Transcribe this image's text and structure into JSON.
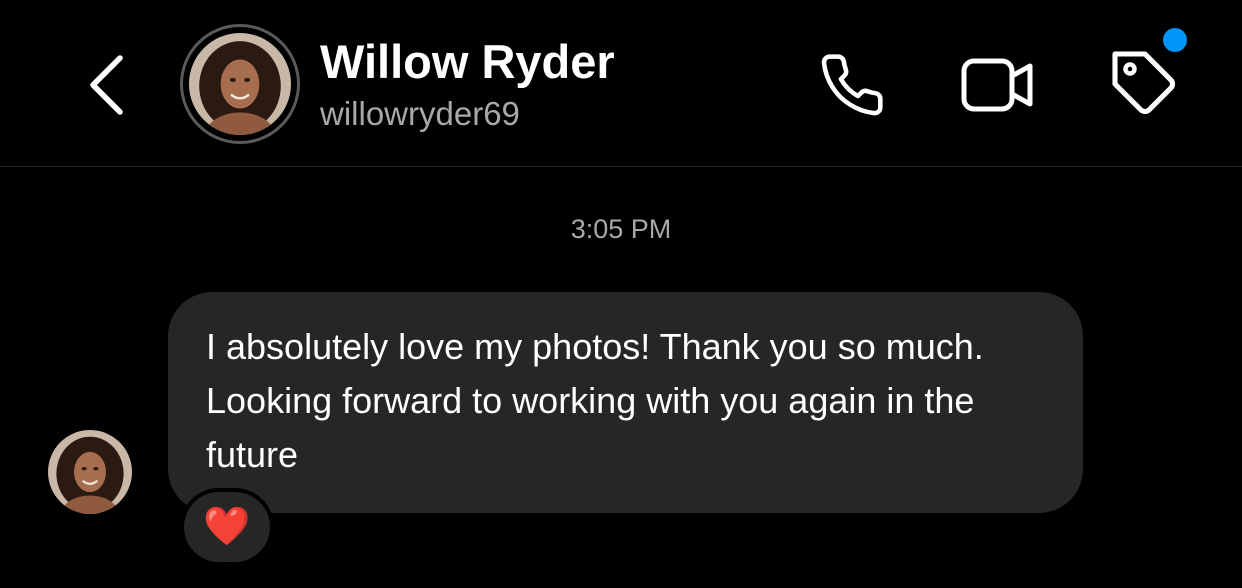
{
  "header": {
    "display_name": "Willow Ryder",
    "username": "willowryder69",
    "icons": {
      "back": "chevron-left-icon",
      "call": "phone-icon",
      "video": "video-camera-icon",
      "tag": "tag-icon"
    },
    "has_notification": true
  },
  "conversation": {
    "timestamp": "3:05 PM",
    "messages": [
      {
        "text": "I absolutely love my photos! Thank you so much. Looking forward to working with you again in the future",
        "reaction": "❤️"
      }
    ]
  },
  "colors": {
    "background": "#000000",
    "bubble": "#262626",
    "secondary_text": "#a8a8a8",
    "accent": "#0095f6"
  }
}
